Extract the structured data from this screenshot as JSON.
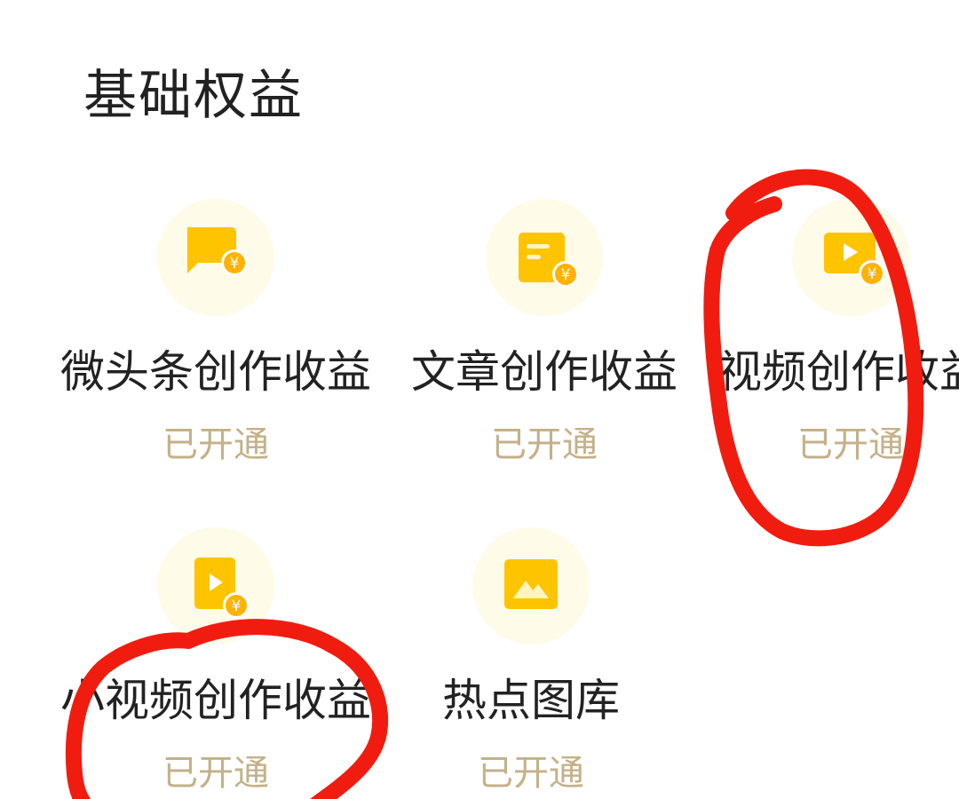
{
  "section": {
    "title": "基础权益"
  },
  "benefits": [
    {
      "name": "微头条创作收益",
      "status": "已开通",
      "icon": "chat-bubble-yuan-icon"
    },
    {
      "name": "文章创作收益",
      "status": "已开通",
      "icon": "document-yuan-icon"
    },
    {
      "name": "视频创作收益",
      "status": "已开通",
      "icon": "video-play-yuan-icon"
    },
    {
      "name": "小视频创作收益",
      "status": "已开通",
      "icon": "mini-video-yuan-icon"
    },
    {
      "name": "热点图库",
      "status": "已开通",
      "icon": "image-gallery-icon"
    }
  ],
  "colors": {
    "icon_gold": "#ffc400",
    "icon_bg": "#fffbe9",
    "status_text": "#c3b189",
    "title_text": "#222222",
    "annotation_red": "#f01c10"
  }
}
